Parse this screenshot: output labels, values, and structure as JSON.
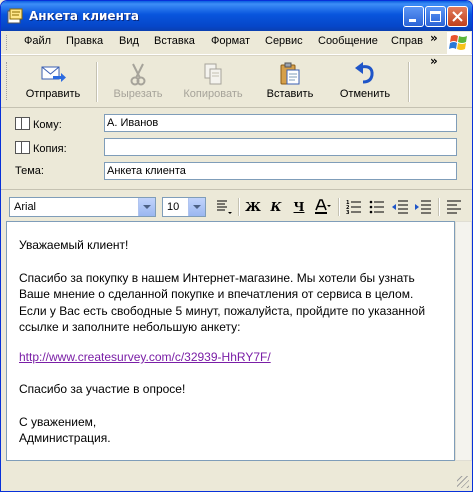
{
  "window": {
    "title": "Анкета клиента",
    "controls": [
      "minimize-icon",
      "maximize-icon",
      "close-icon"
    ]
  },
  "menu": {
    "items": [
      "Файл",
      "Правка",
      "Вид",
      "Вставка",
      "Формат",
      "Сервис",
      "Сообщение",
      "Справ"
    ],
    "overflow": "»"
  },
  "toolbar": {
    "overflow": "»",
    "buttons": [
      {
        "label": "Отправить",
        "icon": "send-icon",
        "enabled": true
      },
      {
        "label": "Вырезать",
        "icon": "scissors-icon",
        "enabled": false
      },
      {
        "label": "Копировать",
        "icon": "copy-icon",
        "enabled": false
      },
      {
        "label": "Вставить",
        "icon": "paste-icon",
        "enabled": true
      },
      {
        "label": "Отменить",
        "icon": "undo-icon",
        "enabled": true
      }
    ]
  },
  "header": {
    "to": {
      "label": "Кому:",
      "value": "А. Иванов"
    },
    "cc": {
      "label": "Копия:",
      "value": ""
    },
    "subject": {
      "label": "Тема:",
      "value": "Анкета клиента"
    }
  },
  "format": {
    "font": "Arial",
    "size": "10",
    "buttons": [
      "Ж",
      "К",
      "Ч"
    ]
  },
  "message": {
    "greeting": "Уважаемый клиент!",
    "paragraph1": "Спасибо за покупку в нашем Интернет-магазине. Мы хотели бы узнать Ваше мнение о сделанной покупке и впечатления от сервиса в целом. Если у Вас есть свободные 5 минут, пожалуйста, пройдите по указанной ссылке и заполните небольшую анкету:",
    "link": "http://www.createsurvey.com/c/32939-HhRY7F/",
    "thanks": "Спасибо за участие в опросе!",
    "closing1": "С уважением,",
    "closing2": "Администрация."
  },
  "colors": {
    "titlebar": "#0855dd",
    "link": "#7a1ea6",
    "window_bg": "#ece9d8"
  }
}
